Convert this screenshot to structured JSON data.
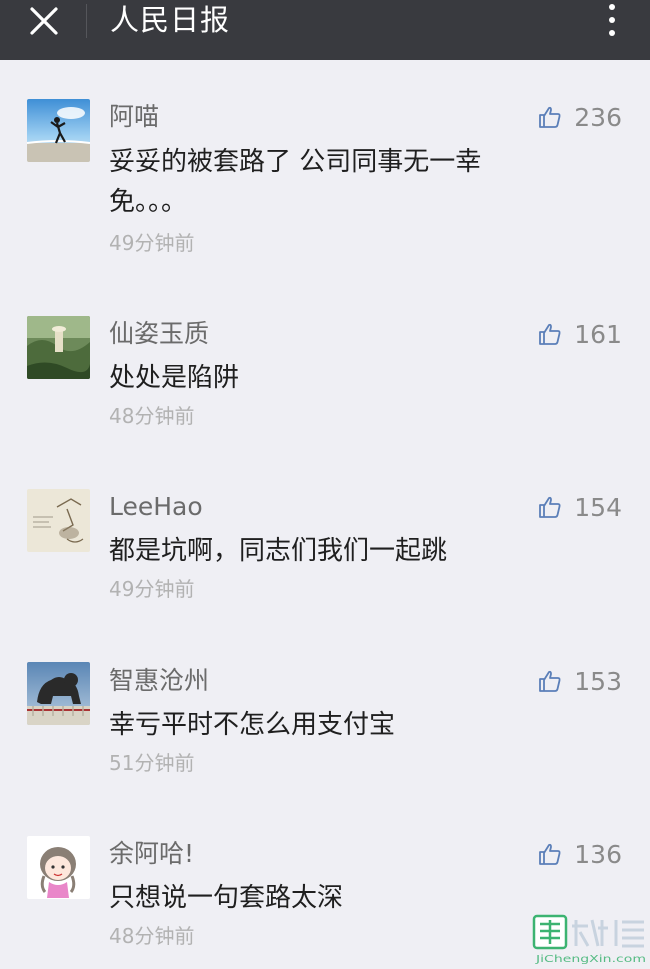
{
  "header": {
    "title": "人民日报",
    "close_icon": "close-icon",
    "more_icon": "more-vertical-icon",
    "background": "#393a3f"
  },
  "comments": [
    {
      "nickname": "阿喵",
      "content": "妥妥的被套路了 公司同事无一幸免。。。",
      "time": "49分钟前",
      "likes": "236",
      "avatar": "beach-photo"
    },
    {
      "nickname": "仙姿玉质",
      "content": "处处是陷阱",
      "time": "48分钟前",
      "likes": "161",
      "avatar": "green-landscape-photo"
    },
    {
      "nickname": "LeeHao",
      "content": "都是坑啊，同志们我们一起跳",
      "time": "49分钟前",
      "likes": "154",
      "avatar": "sketch-drawing"
    },
    {
      "nickname": "智惠沧州",
      "content": "幸亏平时不怎么用支付宝",
      "time": "51分钟前",
      "likes": "153",
      "avatar": "iron-lion-statue-photo"
    },
    {
      "nickname": "余阿哈!",
      "content": "只想说一句套路太深",
      "time": "48分钟前",
      "likes": "136",
      "avatar": "cartoon-girl"
    }
  ],
  "watermark": {
    "logo_text": "集诚信",
    "url_text": "JiChengXin.com",
    "accent": "#3cb371"
  },
  "colors": {
    "background": "#efeff4",
    "like_icon": "#5b7fb8"
  }
}
